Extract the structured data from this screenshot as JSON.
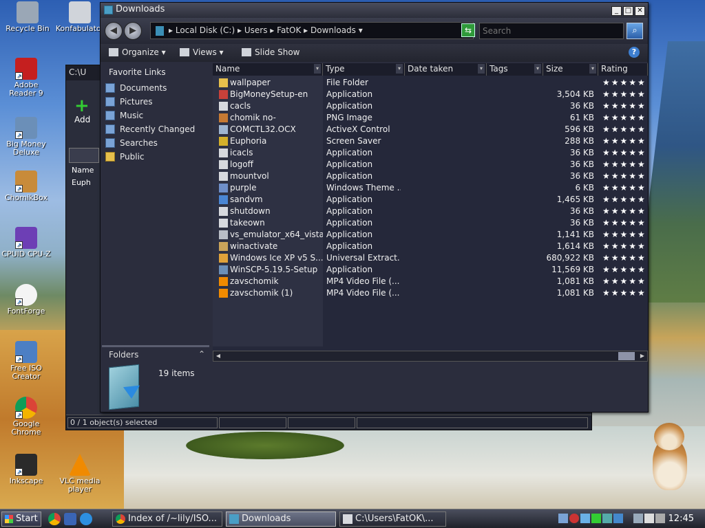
{
  "desktop": {
    "icons": [
      {
        "label": "Recycle Bin",
        "color": "#9aa7b6"
      },
      {
        "label": "Konfabulator",
        "color": "#d0d4da"
      },
      {
        "label": "Adobe Reader 9",
        "color": "#c51f1f"
      },
      {
        "label": "Big Money Deluxe",
        "color": "#6b8fb8"
      },
      {
        "label": "ChomikBox",
        "color": "#c88b3a"
      },
      {
        "label": "CPUID CPU-Z",
        "color": "#6d3fb5"
      },
      {
        "label": "FontForge",
        "color": "#f4f4f4"
      },
      {
        "label": "Free ISO Creator",
        "color": "#4c7fc4"
      },
      {
        "label": "Google Chrome",
        "color": "#e0b83a"
      },
      {
        "label": "Inkscape",
        "color": "#2a2a2a"
      },
      {
        "label": "VLC media player",
        "color": "#f08a00"
      }
    ]
  },
  "back_window": {
    "title": "C:\\Users\\FatOK\\...",
    "title_short": "C:\\U",
    "add_label": "Add",
    "name_header": "Name",
    "item": "Euph",
    "status": "0 / 1 object(s) selected"
  },
  "window": {
    "title": "Downloads",
    "address": {
      "parts": [
        "Local Disk (C:)",
        "Users",
        "FatOK",
        "Downloads"
      ],
      "separator": "▸"
    },
    "search_placeholder": "Search",
    "commands": {
      "organize": "Organize",
      "views": "Views",
      "slideshow": "Slide Show"
    },
    "nav": {
      "heading": "Favorite Links",
      "items": [
        "Documents",
        "Pictures",
        "Music",
        "Recently Changed",
        "Searches",
        "Public"
      ],
      "folders_label": "Folders"
    },
    "columns": {
      "name": "Name",
      "type": "Type",
      "date": "Date taken",
      "tags": "Tags",
      "size": "Size",
      "rating": "Rating"
    },
    "files": [
      {
        "name": "wallpaper",
        "type": "File Folder",
        "size": "",
        "icon_color": "#e7c04c"
      },
      {
        "name": "BigMoneySetup-en",
        "type": "Application",
        "size": "3,504 KB",
        "icon_color": "#c8413a"
      },
      {
        "name": "cacls",
        "type": "Application",
        "size": "36 KB",
        "icon_color": "#d7d9de"
      },
      {
        "name": "chomik no-",
        "type": "PNG Image",
        "size": "61 KB",
        "icon_color": "#c77a33"
      },
      {
        "name": "COMCTL32.OCX",
        "type": "ActiveX Control",
        "size": "596 KB",
        "icon_color": "#9fb6d1"
      },
      {
        "name": "Euphoria",
        "type": "Screen Saver",
        "size": "288 KB",
        "icon_color": "#d4b02a"
      },
      {
        "name": "icacls",
        "type": "Application",
        "size": "36 KB",
        "icon_color": "#d7d9de"
      },
      {
        "name": "logoff",
        "type": "Application",
        "size": "36 KB",
        "icon_color": "#d7d9de"
      },
      {
        "name": "mountvol",
        "type": "Application",
        "size": "36 KB",
        "icon_color": "#d7d9de"
      },
      {
        "name": "purple",
        "type": "Windows Theme ...",
        "size": "6 KB",
        "icon_color": "#6f8fc9"
      },
      {
        "name": "sandvm",
        "type": "Application",
        "size": "1,465 KB",
        "icon_color": "#4a86d4"
      },
      {
        "name": "shutdown",
        "type": "Application",
        "size": "36 KB",
        "icon_color": "#d7d9de"
      },
      {
        "name": "takeown",
        "type": "Application",
        "size": "36 KB",
        "icon_color": "#d7d9de"
      },
      {
        "name": "vs_emulator_x64_vista",
        "type": "Application",
        "size": "1,141 KB",
        "icon_color": "#b9bdc6"
      },
      {
        "name": "winactivate",
        "type": "Application",
        "size": "1,614 KB",
        "icon_color": "#c9a35a"
      },
      {
        "name": "Windows Ice XP v5 S...",
        "type": "Universal Extract...",
        "size": "680,922 KB",
        "icon_color": "#e0a23a"
      },
      {
        "name": "WinSCP-5.19.5-Setup",
        "type": "Application",
        "size": "11,569 KB",
        "icon_color": "#6b8fb8"
      },
      {
        "name": "zavschomik",
        "type": "MP4 Video File (...",
        "size": "1,081 KB",
        "icon_color": "#f08a00"
      },
      {
        "name": "zavschomik (1)",
        "type": "MP4 Video File (...",
        "size": "1,081 KB",
        "icon_color": "#f08a00"
      }
    ],
    "rating_text": "★★★★★",
    "item_count": "19 items"
  },
  "taskbar": {
    "start": "Start",
    "tasks": [
      {
        "label": "Index of /~lily/ISO...",
        "active": false
      },
      {
        "label": "Downloads",
        "active": true
      },
      {
        "label": "C:\\Users\\FatOK\\...",
        "active": false
      }
    ],
    "clock": "12:45"
  }
}
